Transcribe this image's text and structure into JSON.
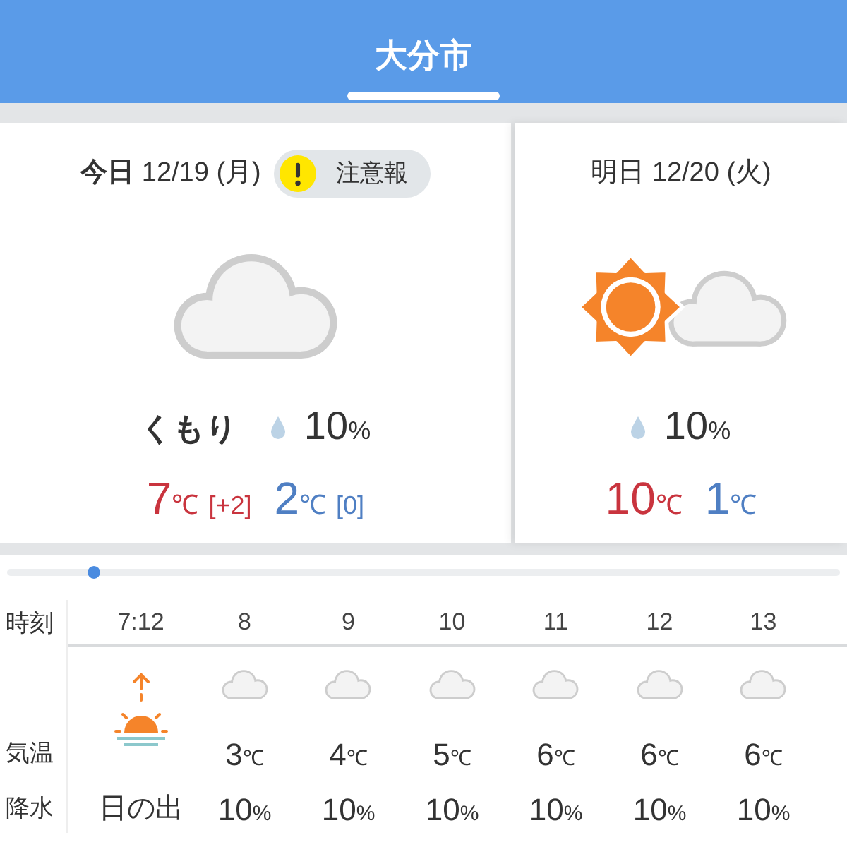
{
  "tabs": [
    {
      "label": "大分市",
      "selected": true
    }
  ],
  "days": [
    {
      "date": "**今日** 12/19 (月)",
      "alert": {
        "label": "注意報"
      },
      "kind": "cloud",
      "condition": "くもり",
      "precip": "10",
      "precip_unit": "%",
      "high": "7",
      "high_unit": "℃",
      "high_diff": "[+2]",
      "low": "2",
      "low_unit": "℃",
      "low_diff": "[0]"
    },
    {
      "date": "明日 12/20 (火)",
      "kind": "suncloud",
      "precip": "10",
      "precip_unit": "%",
      "high": "10",
      "high_unit": "℃",
      "low": "1",
      "low_unit": "℃"
    }
  ],
  "hourly": {
    "row_labels": [
      "時刻",
      "気温",
      "降水"
    ],
    "hours": [
      {
        "time": "7:12",
        "kind": "sunrise",
        "note": "日の出"
      },
      {
        "time": "8",
        "kind": "cloud",
        "temp": "3",
        "temp_unit": "℃",
        "precip": "10",
        "precip_unit": "%"
      },
      {
        "time": "9",
        "kind": "cloud",
        "temp": "4",
        "temp_unit": "℃",
        "precip": "10",
        "precip_unit": "%"
      },
      {
        "time": "10",
        "kind": "cloud",
        "temp": "5",
        "temp_unit": "℃",
        "precip": "10",
        "precip_unit": "%"
      },
      {
        "time": "11",
        "kind": "cloud",
        "temp": "6",
        "temp_unit": "℃",
        "precip": "10",
        "precip_unit": "%"
      },
      {
        "time": "12",
        "kind": "cloud",
        "temp": "6",
        "temp_unit": "℃",
        "precip": "10",
        "precip_unit": "%"
      },
      {
        "time": "13",
        "kind": "cloud",
        "temp": "6",
        "temp_unit": "℃",
        "precip": "10",
        "precip_unit": "%"
      }
    ]
  }
}
